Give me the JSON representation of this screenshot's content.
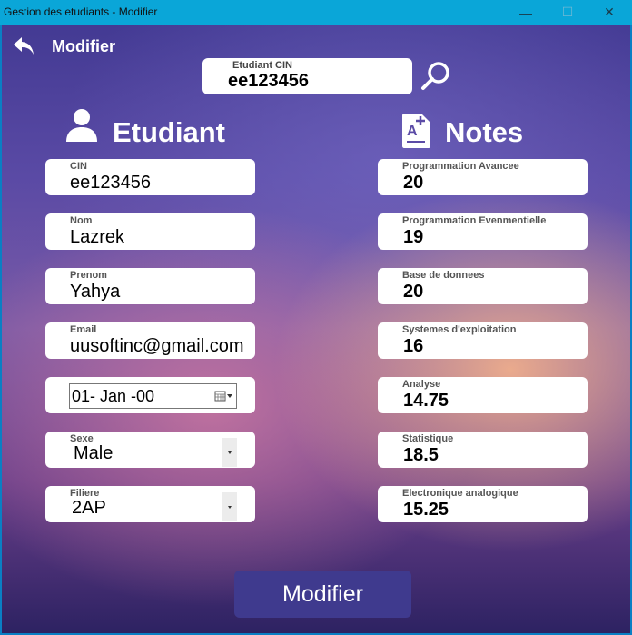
{
  "window": {
    "title": "Gestion des etudiants - Modifier",
    "minimize_glyph": "—",
    "maximize_glyph": "☐",
    "close_glyph": "✕"
  },
  "header": {
    "back_icon": "back-arrow-icon",
    "title": "Modifier"
  },
  "search": {
    "label": "Etudiant CIN",
    "value": "ee123456",
    "icon": "search-icon"
  },
  "etudiant": {
    "title": "Etudiant",
    "icon": "user-icon",
    "cin": {
      "label": "CIN",
      "value": "ee123456"
    },
    "nom": {
      "label": "Nom",
      "value": "Lazrek"
    },
    "prenom": {
      "label": "Prenom",
      "value": "Yahya"
    },
    "email": {
      "label": "Email",
      "value": "uusoftinc@gmail.com"
    },
    "date": {
      "value": "01- Jan -00",
      "icon": "calendar-icon"
    },
    "sexe": {
      "label": "Sexe",
      "value": "Male"
    },
    "filiere": {
      "label": "Filiere",
      "value": "2AP"
    }
  },
  "notes": {
    "title": "Notes",
    "icon": "note-add-icon",
    "items": [
      {
        "label": "Programmation Avancee",
        "value": "20"
      },
      {
        "label": "Programmation Evenmentielle",
        "value": "19"
      },
      {
        "label": "Base de donnees",
        "value": "20"
      },
      {
        "label": "Systemes d'exploitation",
        "value": "16"
      },
      {
        "label": "Analyse",
        "value": "14.75"
      },
      {
        "label": "Statistique",
        "value": "18.5"
      },
      {
        "label": "Electronique analogique",
        "value": "15.25"
      }
    ]
  },
  "submit_label": "Modifier",
  "colors": {
    "titlebar": "#0aa6d8",
    "button": "#3f3a8e"
  }
}
